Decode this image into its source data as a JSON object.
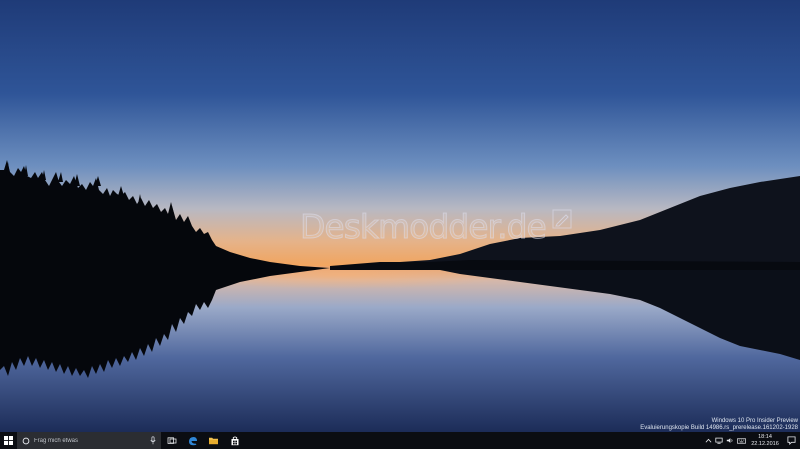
{
  "desktop": {
    "watermark_text": "Deskmodder.de",
    "build_info": {
      "line1": "Windows 10 Pro Insider Preview",
      "line2": "Evaluierungskopie Build 14986.rs_prerelease.161202-1928"
    }
  },
  "taskbar": {
    "start_icon": "windows-logo-icon",
    "search": {
      "placeholder": "Frag mich etwas",
      "value": "",
      "icons": [
        "cortana-circle-icon",
        "microphone-icon"
      ]
    },
    "pinned": [
      {
        "name": "task-view",
        "icon": "task-view-icon"
      },
      {
        "name": "edge",
        "icon": "edge-browser-icon",
        "color": "#2f86d6"
      },
      {
        "name": "file-explorer",
        "icon": "folder-icon",
        "color": "#f2c14e"
      },
      {
        "name": "store",
        "icon": "store-bag-icon"
      }
    ],
    "tray": {
      "icons": [
        "chevron-up-icon",
        "network-icon",
        "volume-icon",
        "keyboard-icon"
      ],
      "time": "18:14",
      "date": "22.12.2016",
      "action_center_icon": "notification-icon"
    }
  },
  "colors": {
    "taskbar_bg": "#0b0d12",
    "search_bg": "#2b2d32",
    "sky_top": "#1f3c78",
    "horizon_glow": "#f2a65a"
  }
}
